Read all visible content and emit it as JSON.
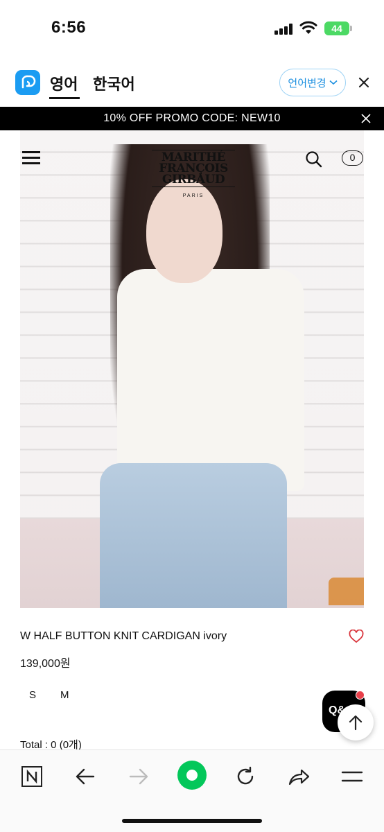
{
  "status_bar": {
    "time": "6:56",
    "battery": "44"
  },
  "translate_bar": {
    "tab_english": "영어",
    "tab_korean": "한국어",
    "change_language": "언어변경"
  },
  "promo": {
    "text": "10% OFF PROMO CODE: NEW10"
  },
  "header": {
    "brand_line1": "MARITHÉ",
    "brand_line2": "FRANÇOIS",
    "brand_line3": "GIRBAUD",
    "brand_sub": "PARIS",
    "cart_count": "0"
  },
  "product": {
    "name": "W HALF BUTTON KNIT CARDIGAN ivory",
    "price": "139,000원",
    "sizes": [
      "S",
      "M"
    ],
    "total": "Total : 0 (0개)"
  },
  "floating": {
    "chat_label": "Q&"
  },
  "colors": {
    "promo_bg": "#000000",
    "translate_accent": "#1b9cf2",
    "toolbar_green": "#03c75a",
    "wishlist_red": "#d9343b"
  },
  "toolbar": {
    "icons": [
      "naver-n-icon",
      "back-arrow-icon",
      "forward-arrow-icon",
      "green-home-icon",
      "reload-icon",
      "share-icon",
      "menu-icon"
    ]
  }
}
